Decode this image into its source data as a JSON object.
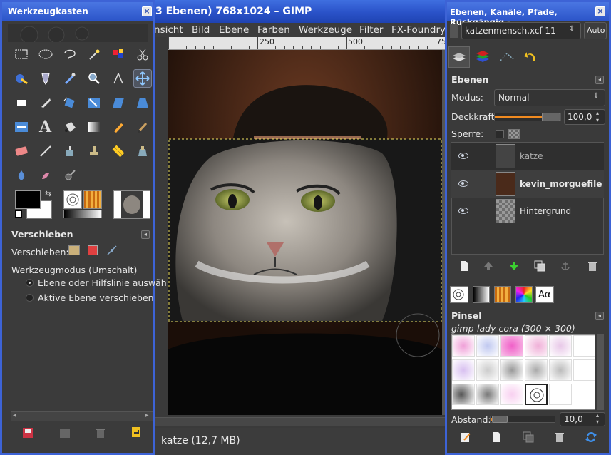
{
  "image_window": {
    "title": "3 Ebenen) 768x1024 – GIMP",
    "menu": [
      "nsicht",
      "Bild",
      "Ebene",
      "Farben",
      "Werkzeuge",
      "Filter",
      "FX-Foundry"
    ],
    "ruler_labels": [
      "250",
      "500",
      "75"
    ],
    "status": "katze (12,7 MB)"
  },
  "toolbox": {
    "title": "Werkzeugkasten",
    "close_label": "×",
    "tool_options": {
      "title": "Verschieben",
      "move_label": "Verschieben:",
      "mode_label": "Werkzeugmodus (Umschalt)",
      "options": [
        "Ebene oder Hilfslinie auswäh",
        "Aktive Ebene verschieben"
      ]
    }
  },
  "dock": {
    "title": "Ebenen, Kanäle, Pfade, Rückgängig - ...",
    "close_label": "×",
    "image_select": "katzenmensch.xcf-11",
    "auto_label": "Auto",
    "layers_title": "Ebenen",
    "mode_label": "Modus:",
    "mode_value": "Normal",
    "opacity_label": "Deckkraft:",
    "opacity_value": "100,0",
    "opacity_fraction": 1.0,
    "lock_label": "Sperre:",
    "layers": [
      {
        "name": "katze",
        "bold": false
      },
      {
        "name": "kevin_morguefile",
        "bold": true
      },
      {
        "name": "Hintergrund",
        "bold": false
      }
    ],
    "brushes_title": "Pinsel",
    "brush_name": "gimp-lady-cora (300 × 300)",
    "spacing_label": "Abstand:",
    "spacing_value": "10,0",
    "spacing_fraction": 0.05,
    "text_tab_label": "Aα"
  },
  "colors": {
    "accent": "#3d63d6",
    "fg": "#000000",
    "bg": "#ffffff"
  }
}
